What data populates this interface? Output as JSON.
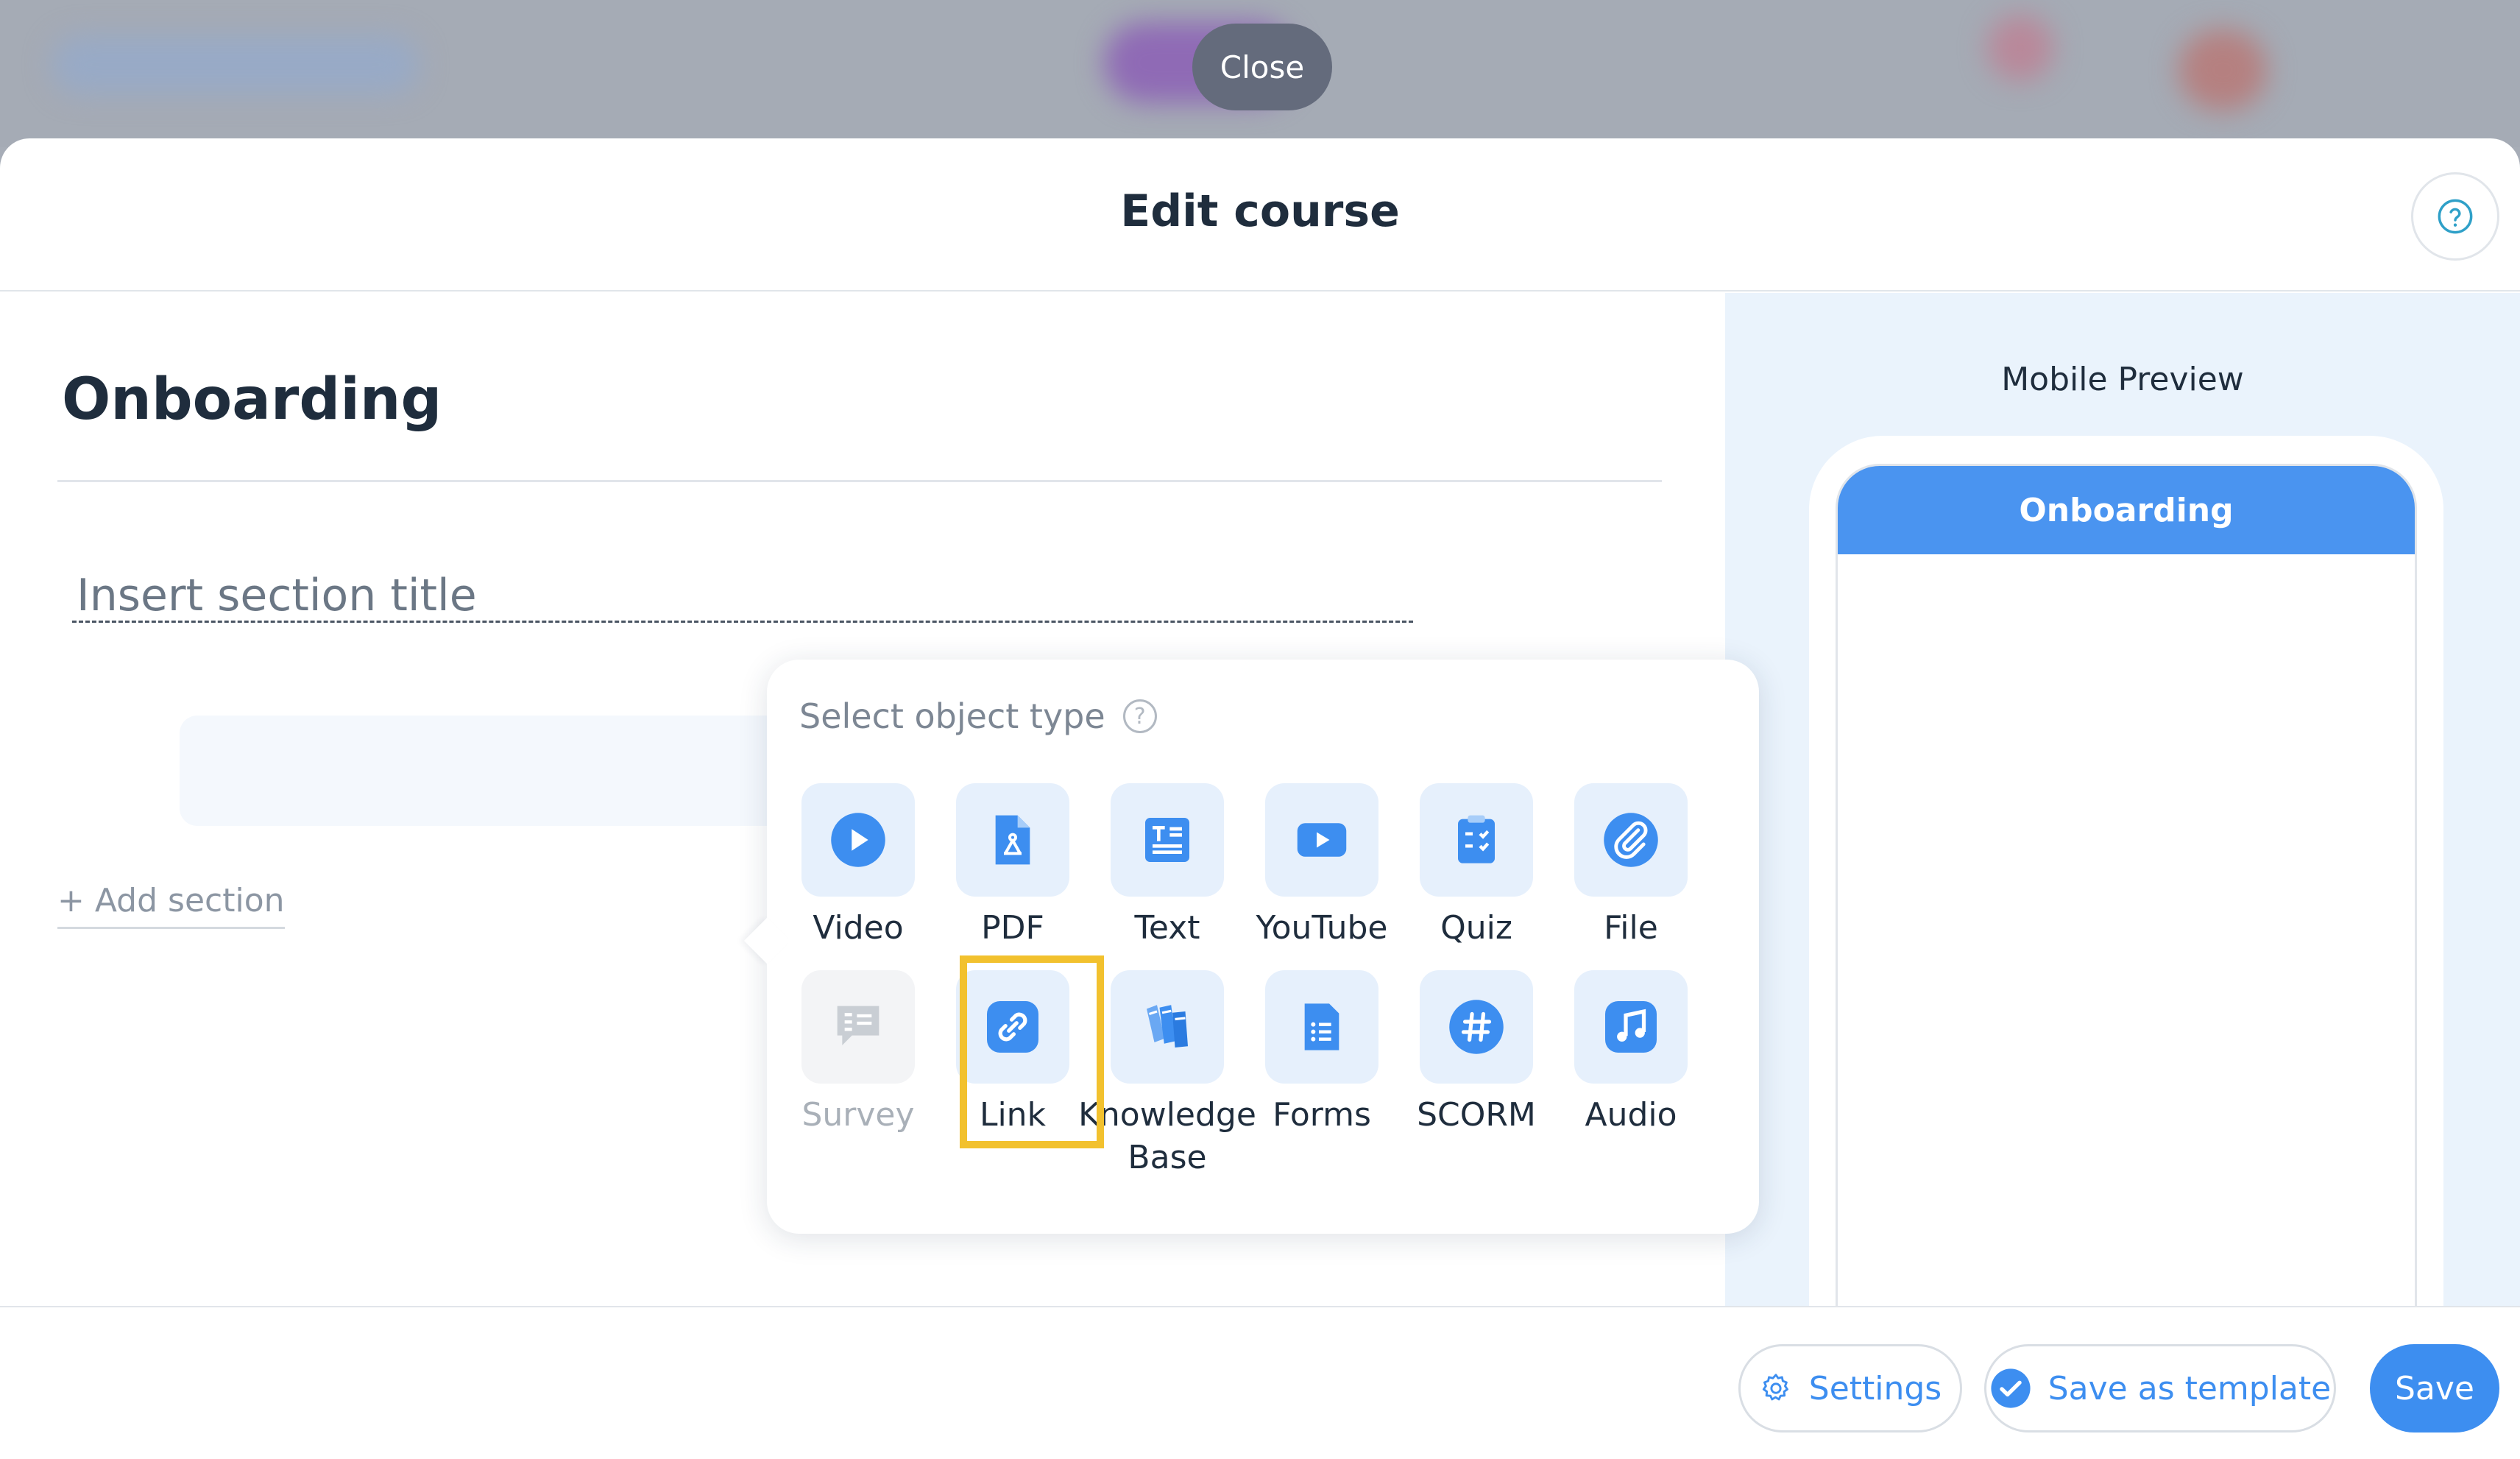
{
  "backdrop": {
    "close_label": "Close"
  },
  "modal": {
    "title": "Edit course",
    "help_icon": "question-circle-icon"
  },
  "editor": {
    "course_title": "Onboarding",
    "section_title_placeholder": "Insert section title",
    "add_section_label": "+ Add section"
  },
  "picker": {
    "title": "Select object type",
    "highlighted_item": "Link",
    "items": [
      {
        "label": "Video",
        "icon": "play-circle-icon",
        "disabled": false
      },
      {
        "label": "PDF",
        "icon": "pdf-file-icon",
        "disabled": false
      },
      {
        "label": "Text",
        "icon": "text-document-icon",
        "disabled": false
      },
      {
        "label": "YouTube",
        "icon": "youtube-icon",
        "disabled": false
      },
      {
        "label": "Quiz",
        "icon": "clipboard-checklist-icon",
        "disabled": false
      },
      {
        "label": "File",
        "icon": "paperclip-icon",
        "disabled": false
      },
      {
        "label": "Survey",
        "icon": "survey-speech-icon",
        "disabled": true
      },
      {
        "label": "Link",
        "icon": "link-chain-icon",
        "disabled": false
      },
      {
        "label": "Knowledge Base",
        "icon": "books-icon",
        "disabled": false
      },
      {
        "label": "Forms",
        "icon": "form-list-icon",
        "disabled": false
      },
      {
        "label": "SCORM",
        "icon": "hashtag-icon",
        "disabled": false
      },
      {
        "label": "Audio",
        "icon": "music-note-icon",
        "disabled": false
      }
    ]
  },
  "preview": {
    "label": "Mobile Preview",
    "course_title": "Onboarding"
  },
  "footer": {
    "settings_label": "Settings",
    "template_label": "Save as template",
    "save_label": "Save"
  },
  "colors": {
    "accent": "#3d8ef0",
    "highlight": "#f2c12e",
    "tile_bg": "#e6f0fc"
  }
}
